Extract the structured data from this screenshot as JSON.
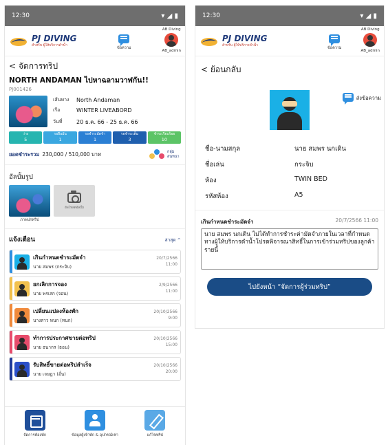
{
  "status": {
    "time": "12:30"
  },
  "logo": {
    "title": "PJ DIVING",
    "subtitle": "สำหรับ ผู้ให้บริการดำน้ำ"
  },
  "header": {
    "message_label": "ข้อความ",
    "org": "AB Diving",
    "user": "AB_admin"
  },
  "screen1": {
    "back_label": "< จัดการทริป",
    "trip_title": "NORTH ANDAMAN ไปหาฉลามวาฬกัน!!",
    "trip_code": "PJ001426",
    "route_label": "เส้นทาง",
    "route_value": "North Andaman",
    "boat_label": "เรือ",
    "boat_value": "WINTER LIVEABORD",
    "date_label": "วันที่",
    "date_value": "20 ธ.ค. 66 - 25 ธ.ค. 66",
    "stats": [
      {
        "label": "ว่าง",
        "value": "5",
        "color": "#26b5b0"
      },
      {
        "label": "รอยืนยัน",
        "value": "1",
        "color": "#3aa7e0"
      },
      {
        "label": "รอชำระมัดจำ",
        "value": "1",
        "color": "#2b7fd4"
      },
      {
        "label": "รอชำระเต็ม",
        "value": "3",
        "color": "#1f5fae"
      },
      {
        "label": "ชำระเรียบร้อย",
        "value": "10",
        "color": "#5cc466"
      }
    ],
    "pay_label": "ยอดชำระรวม",
    "pay_value": "230,000 / 510,000 บาท",
    "group_label": "กลุ่มสนทนา",
    "album_title": "อัลบั้มรูป",
    "album_photo_label": "ภาพปกทริป",
    "upload_label": "อัพโหลดอัลบั้ม",
    "notif_title": "แจ้งเตือน",
    "notif_sort": "ล่าสุด ^",
    "notifications": [
      {
        "title": "เกินกำหนดชำระมัดจำ",
        "name": "นาย สมพร (กระจิบ)",
        "date": "20/7/2566",
        "time": "11:00",
        "bar": "#2f8fe0",
        "bg": "#1ab0e6"
      },
      {
        "title": "ยกเลิกการจอง",
        "name": "นาย พรเสก (จอน)",
        "date": "2/9/2566",
        "time": "11:00",
        "bar": "#f2c14e",
        "bg": "#f2c14e"
      },
      {
        "title": "เปลี่ยนแปลงห้องพัก",
        "name": "นางสาว ทนก (ทนก)",
        "date": "20/10/2566",
        "time": "9:00",
        "bar": "#f08a3c",
        "bg": "#f08a3c"
      },
      {
        "title": "ทำการประกาศขายต่อทริป",
        "name": "นาย ธนากร (ธอน)",
        "date": "20/10/2566",
        "time": "15:00",
        "bar": "#e74c6c",
        "bg": "#e74c6c"
      },
      {
        "title": "รับสิทธิ์ขายต่อทริปสำเร็จ",
        "name": "นาย เจษฎา (อั๋น)",
        "date": "20/10/2566",
        "time": "20:00",
        "bar": "#1f3a9a",
        "bg": "#2b4fc8"
      }
    ],
    "nav": [
      {
        "label": "จัดการห้องพัก"
      },
      {
        "label": "ข้อมูลผู้เข้าพัก & อุปกรณ์เช่า"
      },
      {
        "label": "แก้ไขทริป"
      }
    ]
  },
  "screen2": {
    "back_label": "< ย้อนกลับ",
    "send_msg": "ส่งข้อความ",
    "rows": [
      {
        "label": "ชื่อ-นามสกุล",
        "value": "นาย สมพร นกเดิน"
      },
      {
        "label": "ชื่อเล่น",
        "value": "กระจิบ"
      },
      {
        "label": "ห้อง",
        "value": "TWIN BED"
      },
      {
        "label": "รหัสห้อง",
        "value": "A5"
      }
    ],
    "due_title": "เกินกำหนดชำระมัดจำ",
    "due_date": "20/7/2566 11:00",
    "due_body": "นาย สมพร นกเดิน ไม่ได้ทำการชำระค่ามัดจำภายในเวลาที่กำหนด ทางผู้ให้บริการดำน้ำโปรดพิจารณาสิทธิ์ในการเข้าร่วมทริปของลูกค้ารายนี้",
    "goto_label": "ไปยังหน้า “จัดการผู้ร่วมทริป”"
  }
}
